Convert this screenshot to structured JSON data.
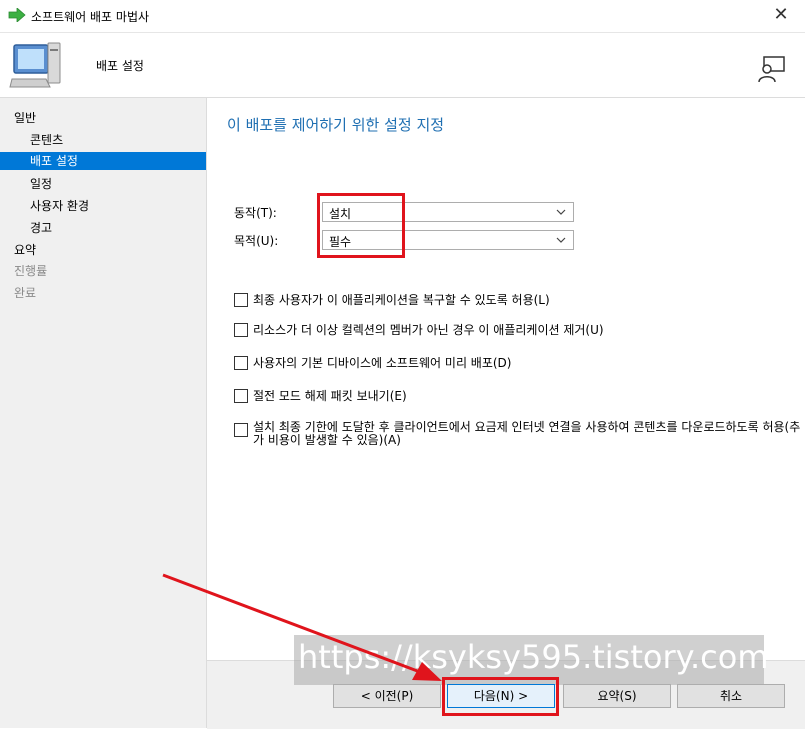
{
  "window": {
    "title": "소프트웨어 배포 마법사",
    "close_glyph": "✕"
  },
  "header": {
    "title": "배포 설정"
  },
  "sidebar": {
    "items": [
      {
        "label": "일반"
      },
      {
        "label": "콘텐츠"
      },
      {
        "label": "배포 설정"
      },
      {
        "label": "일정"
      },
      {
        "label": "사용자 환경"
      },
      {
        "label": "경고"
      },
      {
        "label": "요약"
      },
      {
        "label": "진행률"
      },
      {
        "label": "완료"
      }
    ]
  },
  "main": {
    "heading": "이 배포를 제어하기 위한 설정 지정",
    "action_label": "동작(T):",
    "action_value": "설치",
    "purpose_label": "목적(U):",
    "purpose_value": "필수",
    "checkboxes": [
      {
        "label": "최종 사용자가 이 애플리케이션을 복구할 수 있도록 허용(L)",
        "checked": false
      },
      {
        "label": "리소스가 더 이상 컬렉션의 멤버가 아닌 경우 이 애플리케이션 제거(U)",
        "checked": false
      },
      {
        "label": "사용자의 기본 디바이스에 소프트웨어 미리 배포(D)",
        "checked": false
      },
      {
        "label": "절전 모드 해제 패킷 보내기(E)",
        "checked": false
      },
      {
        "label": "설치 최종 기한에 도달한 후 클라이언트에서 요금제 인터넷 연결을 사용하여 콘텐츠를 다운로드하도록 허용(추가 비용이 발생할 수 있음)(A)",
        "checked": false
      }
    ]
  },
  "footer": {
    "back": "< 이전(P)",
    "next": "다음(N) >",
    "summary": "요약(S)",
    "cancel": "취소"
  },
  "watermark": "https://ksyksy595.tistory.com",
  "icons": [
    "green-arrow-icon",
    "computer-icon",
    "help-person-icon",
    "chevron-down-icon"
  ],
  "colors": {
    "accent": "#0078d7",
    "highlight_box": "#e0141c",
    "heading": "#1f6fb2"
  }
}
